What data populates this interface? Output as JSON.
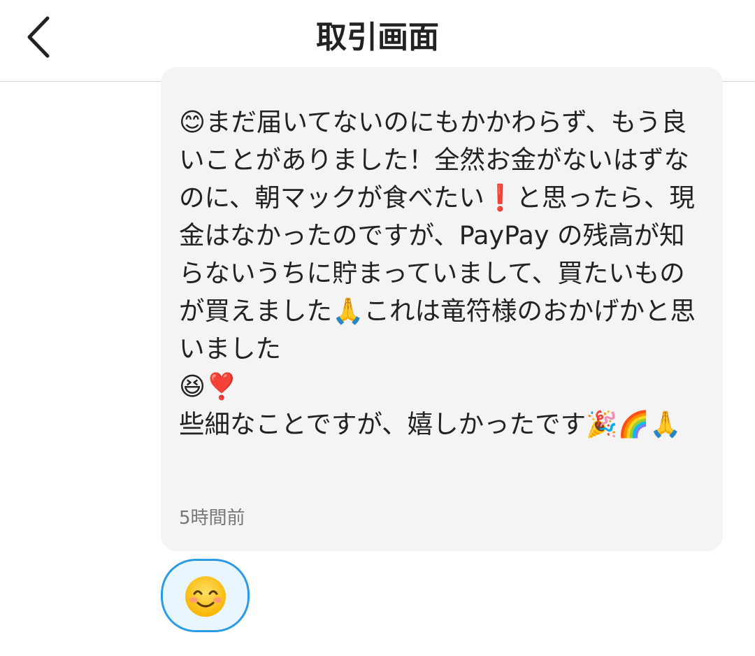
{
  "header": {
    "title": "取引画面",
    "back_icon": "chevron-left-icon"
  },
  "message": {
    "text": "😊まだ届いてないのにもかかわらず、もう良いことがありました！全然お金がないはずなのに、朝マックが食べたい❗と思ったら、現金はなかったのですが、PayPay の残高が知らないうちに貯まっていまして、買たいものが買えました🙏これは竜符様のおかげかと思いました\n😆❣️\n些細なことですが、嬉しかったです🎉🌈🙏",
    "timestamp": "5時間前"
  },
  "reaction": {
    "emoji_icon": "smiling-face-icon"
  },
  "colors": {
    "bubble_bg": "#f4f4f4",
    "reaction_border": "#2c9be6",
    "reaction_bg": "#eaf6fd",
    "timestamp": "#777777"
  }
}
